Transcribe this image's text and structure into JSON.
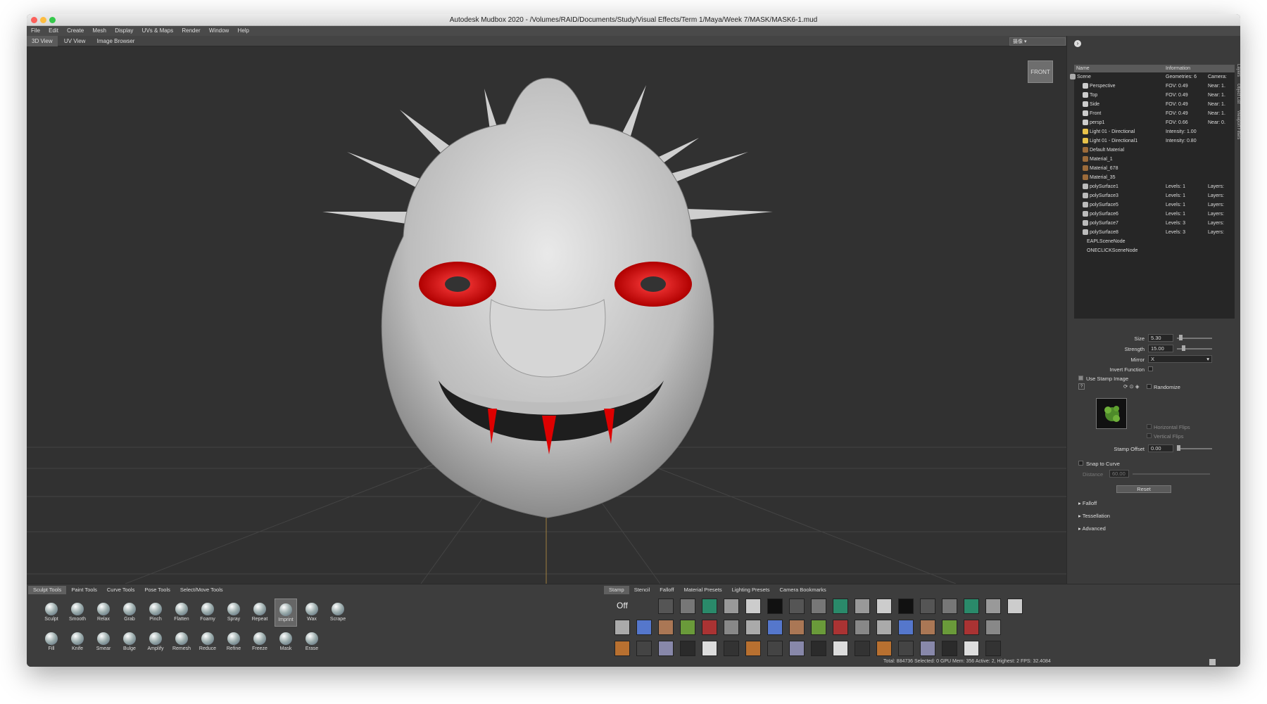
{
  "window": {
    "title": "Autodesk Mudbox 2020 - /Volumes/RAID/Documents/Study/Visual Effects/Term 1/Maya/Week 7/MASK/MASK6-1.mud"
  },
  "menu": [
    "File",
    "Edit",
    "Create",
    "Mesh",
    "Display",
    "UVs & Maps",
    "Render",
    "Window",
    "Help"
  ],
  "view_tabs": [
    "3D View",
    "UV View",
    "Image Browser"
  ],
  "viewport": {
    "cube_label": "FRONT",
    "camera_selector": "摄像"
  },
  "object_list": {
    "headers": {
      "name": "Name",
      "info": "Information"
    },
    "rows": [
      {
        "name": "Scene",
        "i1": "Geometries: 6",
        "i2": "Camera:"
      },
      {
        "name": "Perspective",
        "i1": "FOV: 0.49",
        "i2": "Near: 1."
      },
      {
        "name": "Top",
        "i1": "FOV: 0.49",
        "i2": "Near: 1."
      },
      {
        "name": "Side",
        "i1": "FOV: 0.49",
        "i2": "Near: 1."
      },
      {
        "name": "Front",
        "i1": "FOV: 0.49",
        "i2": "Near: 1."
      },
      {
        "name": "persp1",
        "i1": "FOV: 0.66",
        "i2": "Near: 0."
      },
      {
        "name": "Light 01 - Directional",
        "i1": "Intensity: 1.00",
        "i2": ""
      },
      {
        "name": "Light 01 - Directional1",
        "i1": "Intensity: 0.80",
        "i2": ""
      },
      {
        "name": "Default Material",
        "i1": "",
        "i2": ""
      },
      {
        "name": "Material_1",
        "i1": "",
        "i2": ""
      },
      {
        "name": "Material_678",
        "i1": "",
        "i2": ""
      },
      {
        "name": "Material_35",
        "i1": "",
        "i2": ""
      },
      {
        "name": "polySurface1",
        "i1": "Levels: 1",
        "i2": "Layers:"
      },
      {
        "name": "polySurface3",
        "i1": "Levels: 1",
        "i2": "Layers:"
      },
      {
        "name": "polySurface5",
        "i1": "Levels: 1",
        "i2": "Layers:"
      },
      {
        "name": "polySurface6",
        "i1": "Levels: 1",
        "i2": "Layers:"
      },
      {
        "name": "polySurface7",
        "i1": "Levels: 3",
        "i2": "Layers:"
      },
      {
        "name": "polySurface8",
        "i1": "Levels: 3",
        "i2": "Layers:"
      },
      {
        "name": "EAPLSceneNode",
        "i1": "",
        "i2": ""
      },
      {
        "name": "ONECLICKSceneNode",
        "i1": "",
        "i2": ""
      }
    ]
  },
  "properties": {
    "size_label": "Size",
    "size": "5.30",
    "strength_label": "Strength",
    "strength": "15.00",
    "mirror_label": "Mirror",
    "mirror": "X",
    "invert": "Invert Function",
    "use_stamp": "Use Stamp Image",
    "randomize": "Randomize",
    "hflip": "Horizontal Flips",
    "vflip": "Vertical Flips",
    "stamp_offset_label": "Stamp Offset",
    "stamp_offset": "0.00",
    "snap": "Snap to Curve",
    "distance_label": "Distance",
    "distance": "60.00",
    "reset": "Reset",
    "sections": [
      "Falloff",
      "Tessellation",
      "Advanced"
    ]
  },
  "side_tabs": [
    "Layers",
    "Object List",
    "Viewport Filters"
  ],
  "tool_tabs": [
    "Sculpt Tools",
    "Paint Tools",
    "Curve Tools",
    "Pose Tools",
    "Select/Move Tools"
  ],
  "tools_row1": [
    "Sculpt",
    "Smooth",
    "Relax",
    "Grab",
    "Pinch",
    "Flatten",
    "Foamy",
    "Spray",
    "Repeat",
    "Imprint",
    "Wax",
    "Scrape"
  ],
  "tools_row2": [
    "Fill",
    "Knife",
    "Smear",
    "Bulge",
    "Amplify",
    "Remesh",
    "Reduce",
    "Refine",
    "Freeze",
    "Mask",
    "Erase"
  ],
  "tray_tabs": [
    "Stamp",
    "Stencil",
    "Falloff",
    "Material Presets",
    "Lighting Presets",
    "Camera Bookmarks"
  ],
  "stamp_off": "Off",
  "status": "Total: 884736  Selected: 0 GPU Mem: 356  Active: 2, Highest: 2  FPS: 32.4084"
}
